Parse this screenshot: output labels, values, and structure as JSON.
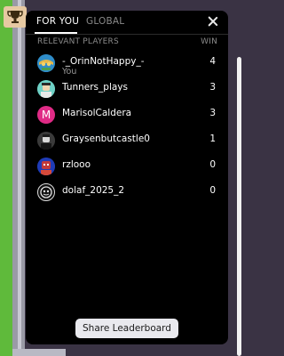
{
  "tabs": [
    {
      "label": "FOR YOU",
      "active": true
    },
    {
      "label": "GLOBAL",
      "active": false
    }
  ],
  "columns": {
    "players": "RELEVANT PLAYERS",
    "win": "WIN"
  },
  "players": [
    {
      "name": "-_OrinNotHappy_-",
      "sub": "You",
      "wins": "4",
      "avatar": "globe-character"
    },
    {
      "name": "Tunners_plays",
      "sub": "",
      "wins": "3",
      "avatar": "character-portrait"
    },
    {
      "name": "MarisolCaldera",
      "sub": "",
      "wins": "3",
      "avatar": "letter-initial",
      "initial": "M"
    },
    {
      "name": "Graysenbutcastle0",
      "sub": "",
      "wins": "1",
      "avatar": "character-portrait"
    },
    {
      "name": "rzlooo",
      "sub": "",
      "wins": "0",
      "avatar": "character-portrait"
    },
    {
      "name": "dolaf_2025_2",
      "sub": "",
      "wins": "0",
      "avatar": "character-portrait"
    }
  ],
  "share_button": "Share Leaderboard",
  "colors": {
    "panel": "#000000",
    "accent_pink": "#e02b86",
    "button_bg": "#e9e9ee"
  }
}
